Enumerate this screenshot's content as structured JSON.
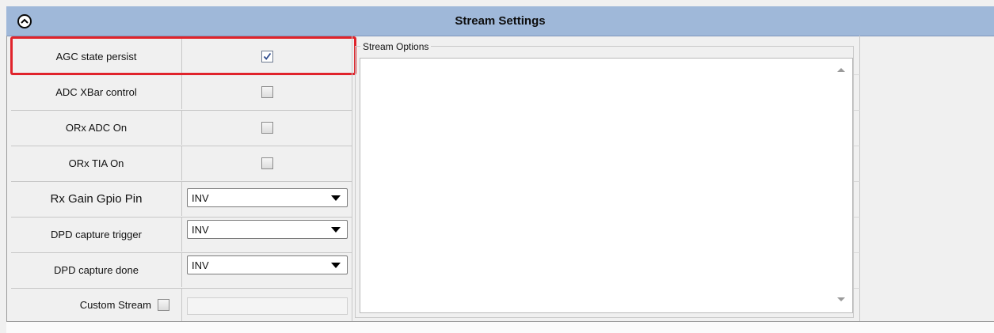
{
  "header": {
    "title": "Stream Settings",
    "collapse_icon": "chevron-up-icon"
  },
  "settings": {
    "agc_state_persist": {
      "label": "AGC state persist",
      "checked": true
    },
    "adc_xbar_control": {
      "label": "ADC XBar control",
      "checked": false
    },
    "orx_adc_on": {
      "label": "ORx ADC On",
      "checked": false
    },
    "orx_tia_on": {
      "label": "ORx TIA On",
      "checked": false
    },
    "rx_gain_gpio_pin": {
      "label": "Rx Gain Gpio Pin",
      "value": "INV"
    },
    "dpd_capture_trigger": {
      "label": "DPD capture trigger",
      "value": "INV"
    },
    "dpd_capture_done": {
      "label": "DPD capture done",
      "value": "INV"
    },
    "custom_stream": {
      "label": "Custom Stream",
      "checked": false,
      "value": ""
    }
  },
  "stream_options": {
    "label": "Stream Options"
  },
  "colors": {
    "header_bg": "#9fb8d9",
    "highlight": "#e0232b"
  }
}
